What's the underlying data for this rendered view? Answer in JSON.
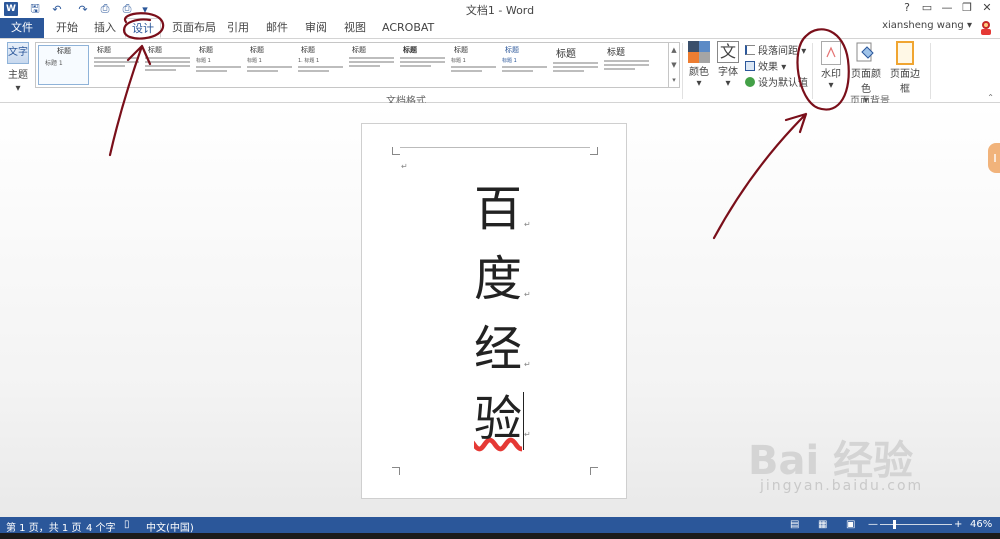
{
  "title_bar": {
    "doc_title": "文档1 - Word",
    "help": "?",
    "ribbon_display": "▭",
    "minimize": "—",
    "restore": "❐",
    "close": "✕"
  },
  "quick_access": {
    "app_icon_letter": "W",
    "save_glyph": "🖫",
    "undo_glyph": "↶",
    "redo_glyph": "↷",
    "preview_glyph": "⎙",
    "customize_glyph": "▾"
  },
  "tabs": [
    {
      "label": "文件"
    },
    {
      "label": "开始"
    },
    {
      "label": "插入"
    },
    {
      "label": "设计"
    },
    {
      "label": "页面布局"
    },
    {
      "label": "引用"
    },
    {
      "label": "邮件"
    },
    {
      "label": "审阅"
    },
    {
      "label": "视图"
    },
    {
      "label": "ACROBAT"
    }
  ],
  "active_tab": "设计",
  "user": {
    "name": "xiansheng wang",
    "menu_glyph": "▾"
  },
  "ribbon": {
    "theme_label": "主题",
    "theme_thumb": "文字",
    "style_gallery": [
      {
        "heading": "标题",
        "sub": "标题 1"
      },
      {
        "heading": "标题",
        "sub": ""
      },
      {
        "heading": "标题",
        "sub": ""
      },
      {
        "heading": "标题",
        "sub": "标题 1"
      },
      {
        "heading": "标题",
        "sub": "标题 1"
      },
      {
        "heading": "标题",
        "sub": "1. 标题 1"
      },
      {
        "heading": "标题",
        "sub": ""
      },
      {
        "heading": "标题",
        "sub": ""
      },
      {
        "heading": "标题",
        "sub": "标题 1"
      },
      {
        "heading": "标题",
        "sub": "标题 1"
      },
      {
        "heading": "标题",
        "sub": ""
      },
      {
        "heading": "标题",
        "sub": ""
      }
    ],
    "gallery_scroll": [
      "▲",
      "▼",
      "▾"
    ],
    "group_format_label": "文档格式",
    "colors_label": "颜色",
    "fonts_label": "字体",
    "fonts_glyph": "文",
    "paragraph_spacing_label": "段落间距",
    "effects_label": "效果",
    "set_default_label": "设为默认值",
    "watermark_label": "水印",
    "page_color_label": "页面颜色",
    "page_border_label": "页面边框",
    "group_bg_label": "页面背景",
    "dropdown_glyph": "▾",
    "collapse_glyph": "⌃",
    "colors": {
      "swatch_1": "#3a4f6b",
      "swatch_2": "#5b8ac6",
      "swatch_3": "#ed7d31",
      "swatch_4": "#a5a5a5"
    }
  },
  "document": {
    "chars": [
      "百",
      "度",
      "经",
      "验"
    ],
    "para_mark": "↵"
  },
  "edge_handle_glyph": "‖",
  "status_bar": {
    "page": "第 1 页，共 1 页",
    "word_count": "4 个字",
    "proofing_glyph": "▯",
    "language": "中文(中国)",
    "read_mode_glyph": "▤",
    "print_layout_glyph": "▦",
    "web_layout_glyph": "▣",
    "zoom_minus": "—",
    "zoom_plus": "+",
    "zoom": "46%",
    "zoom_fraction": 0.46
  },
  "watermark_logo": {
    "brand": "Bai 经验",
    "url": "jingyan.baidu.com"
  },
  "theme_colors": {
    "accent": "#2b579a",
    "annotation": "#7a0f1a"
  }
}
